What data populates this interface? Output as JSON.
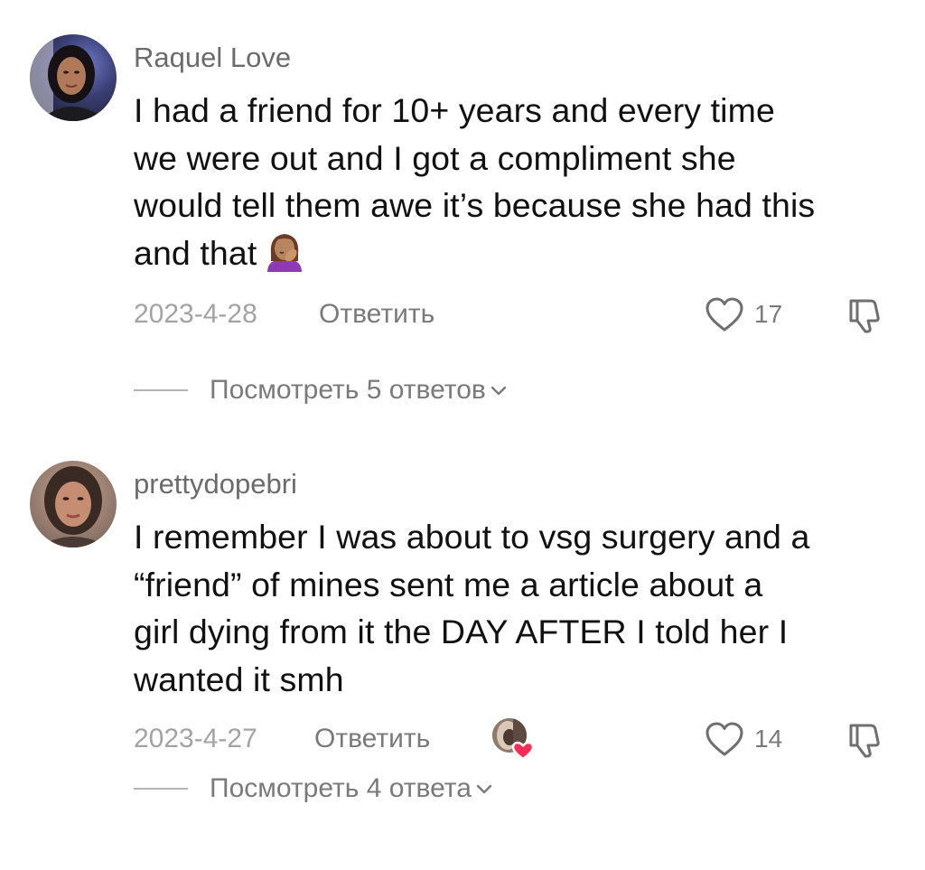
{
  "comments": [
    {
      "username": "Raquel Love",
      "text_lines": [
        "I had a friend for 10+ years and every time",
        "we were out and I got a compliment she",
        "would tell them awe it’s because she had this",
        "and that"
      ],
      "trailing_emoji": "face-palm-woman-emoji",
      "date": "2023-4-28",
      "reply_label": "Ответить",
      "like_count": "17",
      "liked_by_creator": false,
      "view_replies_label": "Посмотреть 5 ответов"
    },
    {
      "username": "prettydopebri",
      "text_lines": [
        "I remember I was about to vsg surgery and a",
        "“friend” of mines sent me a article about a",
        "girl dying from it the DAY AFTER I told her I",
        "wanted it smh"
      ],
      "date": "2023-4-27",
      "reply_label": "Ответить",
      "like_count": "14",
      "liked_by_creator": true,
      "view_replies_label": "Посмотреть 4 ответа"
    }
  ],
  "icons": {
    "like": "heart-outline-icon",
    "dislike": "thumbs-down-outline-icon",
    "expand": "chevron-down-icon",
    "creator_like": "creator-liked-heart-icon"
  },
  "colors": {
    "username": "#6b6b6b",
    "body_text": "#111111",
    "date": "#a3a3a3",
    "secondary": "#7a7a7a",
    "creator_heart": "#fe2c55"
  }
}
